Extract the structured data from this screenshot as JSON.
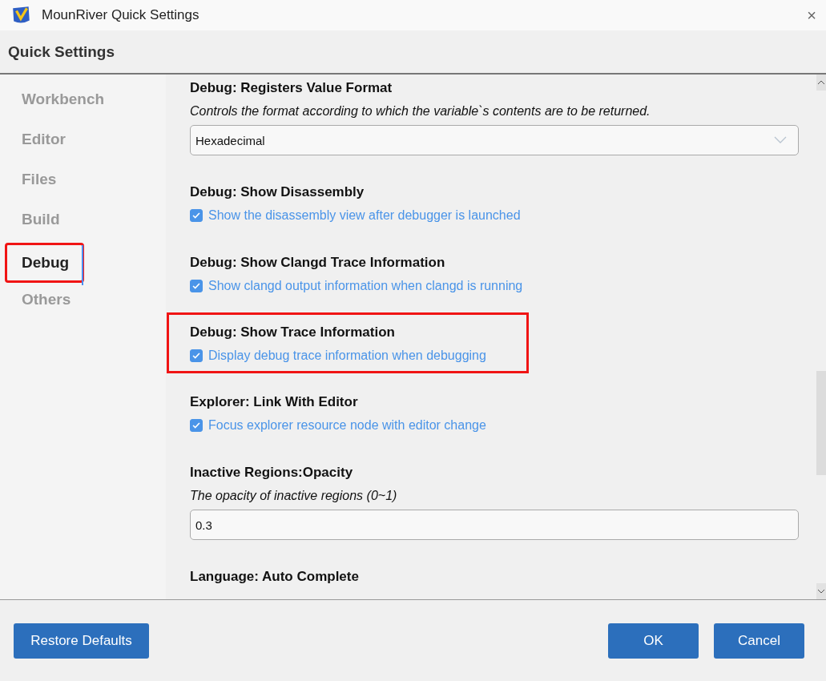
{
  "window": {
    "title": "MounRiver Quick Settings",
    "close": "×"
  },
  "header": {
    "title": "Quick Settings"
  },
  "sidebar": {
    "items": [
      {
        "label": "Workbench",
        "selected": false,
        "highlighted": false
      },
      {
        "label": "Editor",
        "selected": false,
        "highlighted": false
      },
      {
        "label": "Files",
        "selected": false,
        "highlighted": false
      },
      {
        "label": "Build",
        "selected": false,
        "highlighted": false
      },
      {
        "label": "Debug",
        "selected": true,
        "highlighted": true
      },
      {
        "label": "Others",
        "selected": false,
        "highlighted": false
      }
    ]
  },
  "settings": [
    {
      "kind": "select",
      "title": "Debug: Registers Value Format",
      "description": "Controls the format according to which the variable`s contents are to be returned.",
      "value": "Hexadecimal",
      "highlighted": false
    },
    {
      "kind": "checkbox",
      "title": "Debug: Show Disassembly",
      "label": "Show the disassembly view after debugger is launched",
      "checked": true,
      "highlighted": false
    },
    {
      "kind": "checkbox",
      "title": "Debug: Show Clangd Trace Information",
      "label": "Show clangd output information when clangd is running",
      "checked": true,
      "highlighted": false
    },
    {
      "kind": "checkbox",
      "title": "Debug: Show Trace Information",
      "label": "Display debug trace information when debugging",
      "checked": true,
      "highlighted": true
    },
    {
      "kind": "checkbox",
      "title": "Explorer: Link With Editor",
      "label": "Focus explorer resource node with editor change",
      "checked": true,
      "highlighted": false
    },
    {
      "kind": "input",
      "title": "Inactive Regions:Opacity",
      "description": "The opacity of inactive regions (0~1)",
      "value": "0.3",
      "highlighted": false
    },
    {
      "kind": "heading",
      "title": "Language: Auto Complete",
      "highlighted": false
    }
  ],
  "buttons": {
    "left": [
      "Restore Defaults"
    ],
    "right": [
      "OK",
      "Cancel"
    ]
  }
}
